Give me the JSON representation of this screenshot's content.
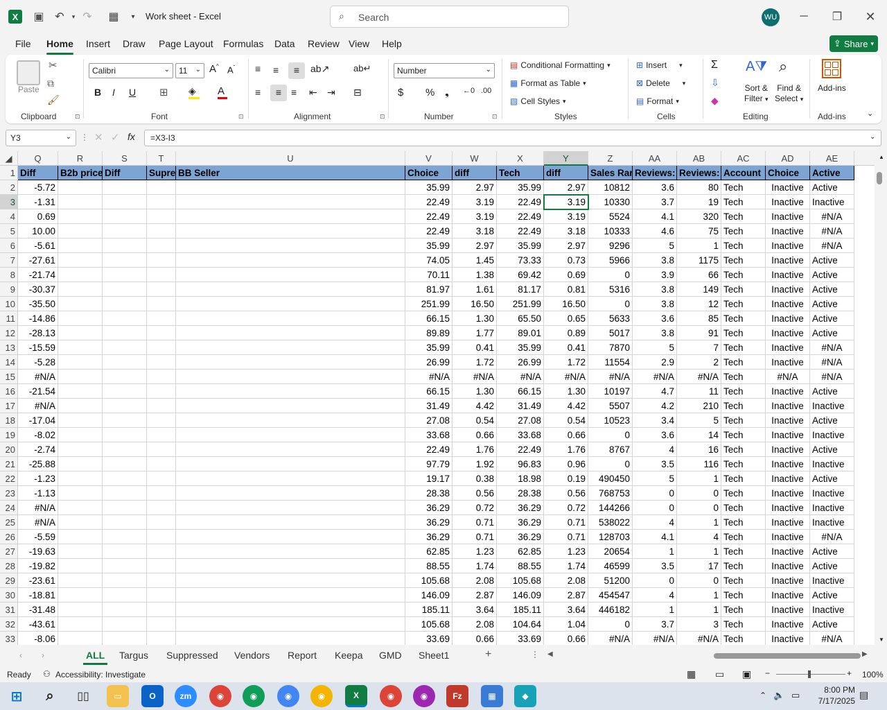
{
  "titlebar": {
    "title": "Work sheet  -  Excel",
    "search_placeholder": "Search",
    "avatar": "WU"
  },
  "tabs": [
    "File",
    "Home",
    "Insert",
    "Draw",
    "Page Layout",
    "Formulas",
    "Data",
    "Review",
    "View",
    "Help"
  ],
  "share": "Share",
  "ribbon": {
    "paste": "Paste",
    "clipboard": "Clipboard",
    "font_name": "Calibri",
    "font_size": "11",
    "font": "Font",
    "alignment": "Alignment",
    "number_format": "Number",
    "number": "Number",
    "cond_format": "Conditional Formatting",
    "format_table": "Format as Table",
    "cell_styles": "Cell Styles",
    "styles": "Styles",
    "insert": "Insert",
    "delete": "Delete",
    "format": "Format",
    "cells": "Cells",
    "sort_filter_1": "Sort &",
    "sort_filter_2": "Filter",
    "find_select_1": "Find &",
    "find_select_2": "Select",
    "editing": "Editing",
    "addins": "Add-ins",
    "addins_group": "Add-ins"
  },
  "formula_bar": {
    "name_box": "Y3",
    "formula": "=X3-I3"
  },
  "columns": [
    "Q",
    "R",
    "S",
    "T",
    "U",
    "V",
    "W",
    "X",
    "Y",
    "Z",
    "AA",
    "AB",
    "AC",
    "AD",
    "AE"
  ],
  "headers": [
    "Diff",
    "B2b price",
    "Diff",
    "Supre",
    "BB Seller",
    "Choice",
    "diff",
    "Tech",
    "diff",
    "Sales Rar",
    "Reviews:",
    "Reviews:",
    "Account",
    "Choice",
    "Active"
  ],
  "rows": [
    [
      "2",
      "-5.72",
      "",
      "",
      "",
      "",
      "35.99",
      "2.97",
      "35.99",
      "2.97",
      "10812",
      "3.6",
      "80",
      "Tech",
      "Inactive",
      "Active"
    ],
    [
      "3",
      "-1.31",
      "",
      "",
      "",
      "",
      "22.49",
      "3.19",
      "22.49",
      "3.19",
      "10330",
      "3.7",
      "19",
      "Tech",
      "Inactive",
      "Inactive"
    ],
    [
      "4",
      "0.69",
      "",
      "",
      "",
      "",
      "22.49",
      "3.19",
      "22.49",
      "3.19",
      "5524",
      "4.1",
      "320",
      "Tech",
      "Inactive",
      "#N/A"
    ],
    [
      "5",
      "10.00",
      "",
      "",
      "",
      "",
      "22.49",
      "3.18",
      "22.49",
      "3.18",
      "10333",
      "4.6",
      "75",
      "Tech",
      "Inactive",
      "#N/A"
    ],
    [
      "6",
      "-5.61",
      "",
      "",
      "",
      "",
      "35.99",
      "2.97",
      "35.99",
      "2.97",
      "9296",
      "5",
      "1",
      "Tech",
      "Inactive",
      "#N/A"
    ],
    [
      "7",
      "-27.61",
      "",
      "",
      "",
      "",
      "74.05",
      "1.45",
      "73.33",
      "0.73",
      "5966",
      "3.8",
      "1175",
      "Tech",
      "Inactive",
      "Active"
    ],
    [
      "8",
      "-21.74",
      "",
      "",
      "",
      "",
      "70.11",
      "1.38",
      "69.42",
      "0.69",
      "0",
      "3.9",
      "66",
      "Tech",
      "Inactive",
      "Active"
    ],
    [
      "9",
      "-30.37",
      "",
      "",
      "",
      "",
      "81.97",
      "1.61",
      "81.17",
      "0.81",
      "5316",
      "3.8",
      "149",
      "Tech",
      "Inactive",
      "Active"
    ],
    [
      "10",
      "-35.50",
      "",
      "",
      "",
      "",
      "251.99",
      "16.50",
      "251.99",
      "16.50",
      "0",
      "3.8",
      "12",
      "Tech",
      "Inactive",
      "Active"
    ],
    [
      "11",
      "-14.86",
      "",
      "",
      "",
      "",
      "66.15",
      "1.30",
      "65.50",
      "0.65",
      "5633",
      "3.6",
      "85",
      "Tech",
      "Inactive",
      "Active"
    ],
    [
      "12",
      "-28.13",
      "",
      "",
      "",
      "",
      "89.89",
      "1.77",
      "89.01",
      "0.89",
      "5017",
      "3.8",
      "91",
      "Tech",
      "Inactive",
      "Active"
    ],
    [
      "13",
      "-15.59",
      "",
      "",
      "",
      "",
      "35.99",
      "0.41",
      "35.99",
      "0.41",
      "7870",
      "5",
      "7",
      "Tech",
      "Inactive",
      "#N/A"
    ],
    [
      "14",
      "-5.28",
      "",
      "",
      "",
      "",
      "26.99",
      "1.72",
      "26.99",
      "1.72",
      "11554",
      "2.9",
      "2",
      "Tech",
      "Inactive",
      "#N/A"
    ],
    [
      "15",
      "#N/A",
      "",
      "",
      "",
      "",
      "#N/A",
      "#N/A",
      "#N/A",
      "#N/A",
      "#N/A",
      "#N/A",
      "#N/A",
      "Tech",
      "#N/A",
      "#N/A"
    ],
    [
      "16",
      "-21.54",
      "",
      "",
      "",
      "",
      "66.15",
      "1.30",
      "66.15",
      "1.30",
      "10197",
      "4.7",
      "11",
      "Tech",
      "Inactive",
      "Active"
    ],
    [
      "17",
      "#N/A",
      "",
      "",
      "",
      "",
      "31.49",
      "4.42",
      "31.49",
      "4.42",
      "5507",
      "4.2",
      "210",
      "Tech",
      "Inactive",
      "Inactive"
    ],
    [
      "18",
      "-17.04",
      "",
      "",
      "",
      "",
      "27.08",
      "0.54",
      "27.08",
      "0.54",
      "10523",
      "3.4",
      "5",
      "Tech",
      "Inactive",
      "Active"
    ],
    [
      "19",
      "-8.02",
      "",
      "",
      "",
      "",
      "33.68",
      "0.66",
      "33.68",
      "0.66",
      "0",
      "3.6",
      "14",
      "Tech",
      "Inactive",
      "Inactive"
    ],
    [
      "20",
      "-2.74",
      "",
      "",
      "",
      "",
      "22.49",
      "1.76",
      "22.49",
      "1.76",
      "8767",
      "4",
      "16",
      "Tech",
      "Inactive",
      "Active"
    ],
    [
      "21",
      "-25.88",
      "",
      "",
      "",
      "",
      "97.79",
      "1.92",
      "96.83",
      "0.96",
      "0",
      "3.5",
      "116",
      "Tech",
      "Inactive",
      "Inactive"
    ],
    [
      "22",
      "-1.23",
      "",
      "",
      "",
      "",
      "19.17",
      "0.38",
      "18.98",
      "0.19",
      "490450",
      "5",
      "1",
      "Tech",
      "Inactive",
      "Active"
    ],
    [
      "23",
      "-1.13",
      "",
      "",
      "",
      "",
      "28.38",
      "0.56",
      "28.38",
      "0.56",
      "768753",
      "0",
      "0",
      "Tech",
      "Inactive",
      "Inactive"
    ],
    [
      "24",
      "#N/A",
      "",
      "",
      "",
      "",
      "36.29",
      "0.72",
      "36.29",
      "0.72",
      "144266",
      "0",
      "0",
      "Tech",
      "Inactive",
      "Inactive"
    ],
    [
      "25",
      "#N/A",
      "",
      "",
      "",
      "",
      "36.29",
      "0.71",
      "36.29",
      "0.71",
      "538022",
      "4",
      "1",
      "Tech",
      "Inactive",
      "Inactive"
    ],
    [
      "26",
      "-5.59",
      "",
      "",
      "",
      "",
      "36.29",
      "0.71",
      "36.29",
      "0.71",
      "128703",
      "4.1",
      "4",
      "Tech",
      "Inactive",
      "#N/A"
    ],
    [
      "27",
      "-19.63",
      "",
      "",
      "",
      "",
      "62.85",
      "1.23",
      "62.85",
      "1.23",
      "20654",
      "1",
      "1",
      "Tech",
      "Inactive",
      "Active"
    ],
    [
      "28",
      "-19.82",
      "",
      "",
      "",
      "",
      "88.55",
      "1.74",
      "88.55",
      "1.74",
      "46599",
      "3.5",
      "17",
      "Tech",
      "Inactive",
      "Active"
    ],
    [
      "29",
      "-23.61",
      "",
      "",
      "",
      "",
      "105.68",
      "2.08",
      "105.68",
      "2.08",
      "51200",
      "0",
      "0",
      "Tech",
      "Inactive",
      "Inactive"
    ],
    [
      "30",
      "-18.81",
      "",
      "",
      "",
      "",
      "146.09",
      "2.87",
      "146.09",
      "2.87",
      "454547",
      "4",
      "1",
      "Tech",
      "Inactive",
      "Active"
    ],
    [
      "31",
      "-31.48",
      "",
      "",
      "",
      "",
      "185.11",
      "3.64",
      "185.11",
      "3.64",
      "446182",
      "1",
      "1",
      "Tech",
      "Inactive",
      "Inactive"
    ],
    [
      "32",
      "-43.61",
      "",
      "",
      "",
      "",
      "105.68",
      "2.08",
      "104.64",
      "1.04",
      "0",
      "3.7",
      "3",
      "Tech",
      "Inactive",
      "Active"
    ],
    [
      "33",
      "-8.06",
      "",
      "",
      "",
      "",
      "33.69",
      "0.66",
      "33.69",
      "0.66",
      "#N/A",
      "#N/A",
      "#N/A",
      "Tech",
      "Inactive",
      "#N/A"
    ]
  ],
  "sheets": [
    "ALL",
    "Targus",
    "Suppressed",
    "Vendors",
    "Report",
    "Keepa",
    "GMD",
    "Sheet1"
  ],
  "status": {
    "ready": "Ready",
    "accessibility": "Accessibility: Investigate",
    "zoom": "100%"
  },
  "taskbar": {
    "time": "8:00 PM",
    "date": "7/17/2025"
  },
  "colors": {
    "excel_green": "#107c41",
    "header_fill": "#7ca5d6"
  }
}
